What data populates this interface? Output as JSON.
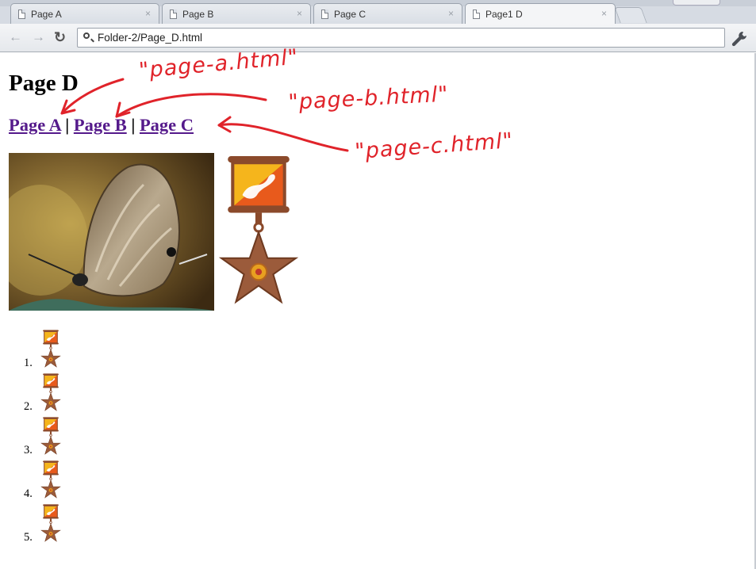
{
  "browser": {
    "tabs": [
      {
        "title": "Page A",
        "close": "×"
      },
      {
        "title": "Page B",
        "close": "×"
      },
      {
        "title": "Page C",
        "close": "×"
      },
      {
        "title": "Page1 D",
        "close": "×"
      }
    ],
    "address": "Folder-2/Page_D.html",
    "back_glyph": "←",
    "forward_glyph": "→",
    "reload_glyph": "↻"
  },
  "page": {
    "title": "Page D",
    "links": [
      "Page A",
      "Page B",
      "Page C"
    ],
    "separator": "|",
    "list_numbers": [
      "1.",
      "2.",
      "3.",
      "4.",
      "5."
    ]
  },
  "annotations": {
    "note_a": "\"page-a.html\"",
    "note_b": "\"page-b.html\"",
    "note_c": "\"page-c.html\"",
    "color": "#e0232a"
  },
  "colors": {
    "link_visited": "#551a8b",
    "medal_brown": "#8b4a2b",
    "flag_yellow": "#f5b51c",
    "flag_orange": "#e85a1c"
  },
  "icons": [
    "page-icon",
    "close-icon",
    "back-arrow-icon",
    "forward-arrow-icon",
    "reload-icon",
    "search-icon",
    "wrench-icon",
    "medal-icon"
  ]
}
